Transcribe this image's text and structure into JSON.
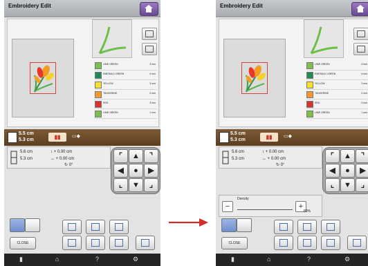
{
  "screens": [
    {
      "title": "Embroidery Edit",
      "threads": [
        {
          "name": "LIME GREEN",
          "length": "3 mm",
          "color": "#7cc04b"
        },
        {
          "name": "EMERALD GREEN",
          "length": "4 mm",
          "color": "#1e8a55"
        },
        {
          "name": "YELLOW",
          "length": "3 mm",
          "color": "#f4e22c"
        },
        {
          "name": "TANGERINE",
          "length": "2 mm",
          "color": "#f39a2a"
        },
        {
          "name": "RED",
          "length": "3 mm",
          "color": "#d9322c"
        },
        {
          "name": "LIME GREEN",
          "length": "1 mm",
          "color": "#7cc04b"
        }
      ],
      "size_width": "5.5",
      "size_height": "5.3",
      "size_unit": "cm",
      "pos_width": "5.6",
      "pos_height": "5.3",
      "pos_unit": "cm",
      "offset_v": "+ 0.00",
      "offset_h": "+ 0.00",
      "offset_unit": "cm",
      "rotation": "0°",
      "close_label": "CLOSE",
      "help_label": "?",
      "show_density": false
    },
    {
      "title": "Embroidery Edit",
      "threads": [
        {
          "name": "LIME GREEN",
          "length": "4 mm",
          "color": "#7cc04b"
        },
        {
          "name": "EMERALD GREEN",
          "length": "4 mm",
          "color": "#1e8a55"
        },
        {
          "name": "YELLOW",
          "length": "3 mm",
          "color": "#f4e22c"
        },
        {
          "name": "TANGERINE",
          "length": "2 mm",
          "color": "#f39a2a"
        },
        {
          "name": "RED",
          "length": "3 mm",
          "color": "#d9322c"
        },
        {
          "name": "LIME GREEN",
          "length": "1 mm",
          "color": "#7cc04b"
        }
      ],
      "size_width": "5.5",
      "size_height": "5.3",
      "size_unit": "cm",
      "pos_width": "5.6",
      "pos_height": "5.3",
      "pos_unit": "cm",
      "offset_v": "+ 0.00",
      "offset_h": "+ 0.00",
      "offset_unit": "cm",
      "rotation": "0°",
      "close_label": "CLOSE",
      "help_label": "?",
      "show_density": true,
      "density_label": "Density",
      "density_value": "80%",
      "density_minus": "−",
      "density_plus": "+"
    }
  ],
  "colors": {
    "accent_purple": "#7b58a6",
    "bar_brown": "#6a4a28",
    "arrow_red": "#d42b2b"
  },
  "icons": [
    "home-icon",
    "camera-icon",
    "repeat-icon",
    "arrow-up-icon",
    "arrow-down-icon",
    "arrow-left-icon",
    "arrow-right-icon",
    "center-icon",
    "help-icon",
    "sewing-machine-icon"
  ]
}
